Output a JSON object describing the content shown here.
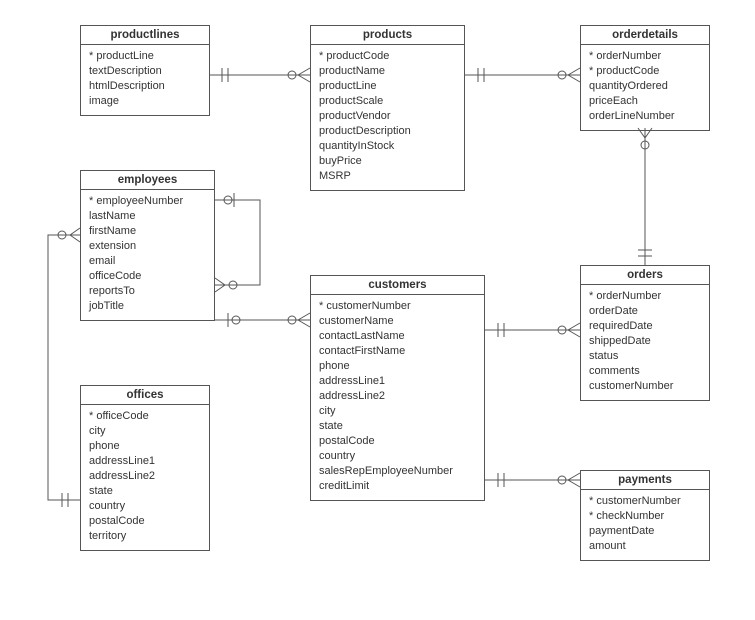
{
  "entities": {
    "productlines": {
      "title": "productlines",
      "attrs": [
        "* productLine",
        "textDescription",
        "htmlDescription",
        "image"
      ]
    },
    "products": {
      "title": "products",
      "attrs": [
        "* productCode",
        "productName",
        "productLine",
        "productScale",
        "productVendor",
        "productDescription",
        "quantityInStock",
        "buyPrice",
        "MSRP"
      ]
    },
    "orderdetails": {
      "title": "orderdetails",
      "attrs": [
        "* orderNumber",
        "* productCode",
        "quantityOrdered",
        "priceEach",
        "orderLineNumber"
      ]
    },
    "employees": {
      "title": "employees",
      "attrs": [
        "* employeeNumber",
        "lastName",
        "firstName",
        "extension",
        "email",
        "officeCode",
        "reportsTo",
        "jobTitle"
      ]
    },
    "customers": {
      "title": "customers",
      "attrs": [
        "* customerNumber",
        "customerName",
        "contactLastName",
        "contactFirstName",
        "phone",
        "addressLine1",
        "addressLine2",
        "city",
        "state",
        "postalCode",
        "country",
        "salesRepEmployeeNumber",
        "creditLimit"
      ]
    },
    "orders": {
      "title": "orders",
      "attrs": [
        "* orderNumber",
        "orderDate",
        "requiredDate",
        "shippedDate",
        "status",
        "comments",
        "customerNumber"
      ]
    },
    "offices": {
      "title": "offices",
      "attrs": [
        "* officeCode",
        "city",
        "phone",
        "addressLine1",
        "addressLine2",
        "state",
        "country",
        "postalCode",
        "territory"
      ]
    },
    "payments": {
      "title": "payments",
      "attrs": [
        "* customerNumber",
        "* checkNumber",
        "paymentDate",
        "amount"
      ]
    }
  },
  "relationships": [
    {
      "from": "productlines",
      "to": "products",
      "fromCard": "one",
      "toCard": "many"
    },
    {
      "from": "products",
      "to": "orderdetails",
      "fromCard": "one",
      "toCard": "many"
    },
    {
      "from": "orderdetails",
      "to": "orders",
      "fromCard": "many",
      "toCard": "one"
    },
    {
      "from": "customers",
      "to": "orders",
      "fromCard": "one",
      "toCard": "many"
    },
    {
      "from": "customers",
      "to": "payments",
      "fromCard": "one",
      "toCard": "many"
    },
    {
      "from": "employees",
      "to": "customers",
      "fromCard": "one",
      "toCard": "many"
    },
    {
      "from": "employees",
      "to": "employees",
      "fromCard": "one",
      "toCard": "many",
      "note": "self reportsTo"
    },
    {
      "from": "offices",
      "to": "employees",
      "fromCard": "one",
      "toCard": "many"
    }
  ]
}
